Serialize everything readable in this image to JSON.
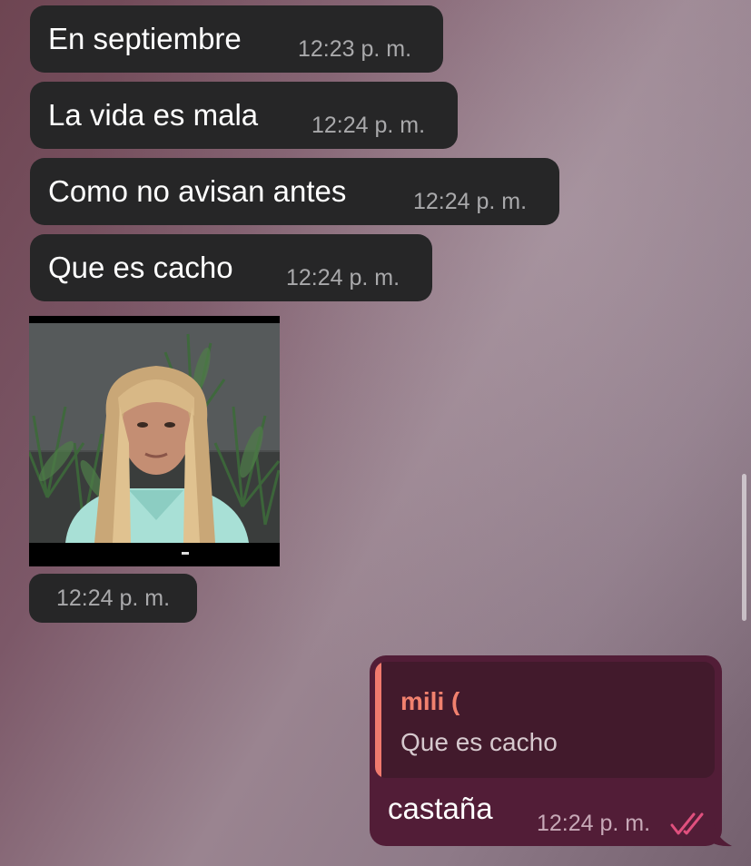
{
  "messages_in": [
    {
      "text": "En septiembre",
      "time": "12:23 p. m."
    },
    {
      "text": "La vida es mala",
      "time": "12:24 p. m."
    },
    {
      "text": "Como no avisan antes",
      "time": "12:24 p. m."
    },
    {
      "text": "Que es cacho",
      "time": "12:24 p. m."
    }
  ],
  "photo_message": {
    "time": "12:24 p. m.",
    "image": "person-with-long-blonde-hair-photo"
  },
  "outgoing": {
    "reply": {
      "author": "mili (",
      "text": "Que es cacho"
    },
    "text": "castaña",
    "time": "12:24 p. m.",
    "status_icon": "double-check-icon"
  },
  "colors": {
    "incoming_bubble": "#262627",
    "outgoing_bubble": "#521d37",
    "reply_accent": "#f07a6e",
    "read_checks": "#e0507e"
  }
}
